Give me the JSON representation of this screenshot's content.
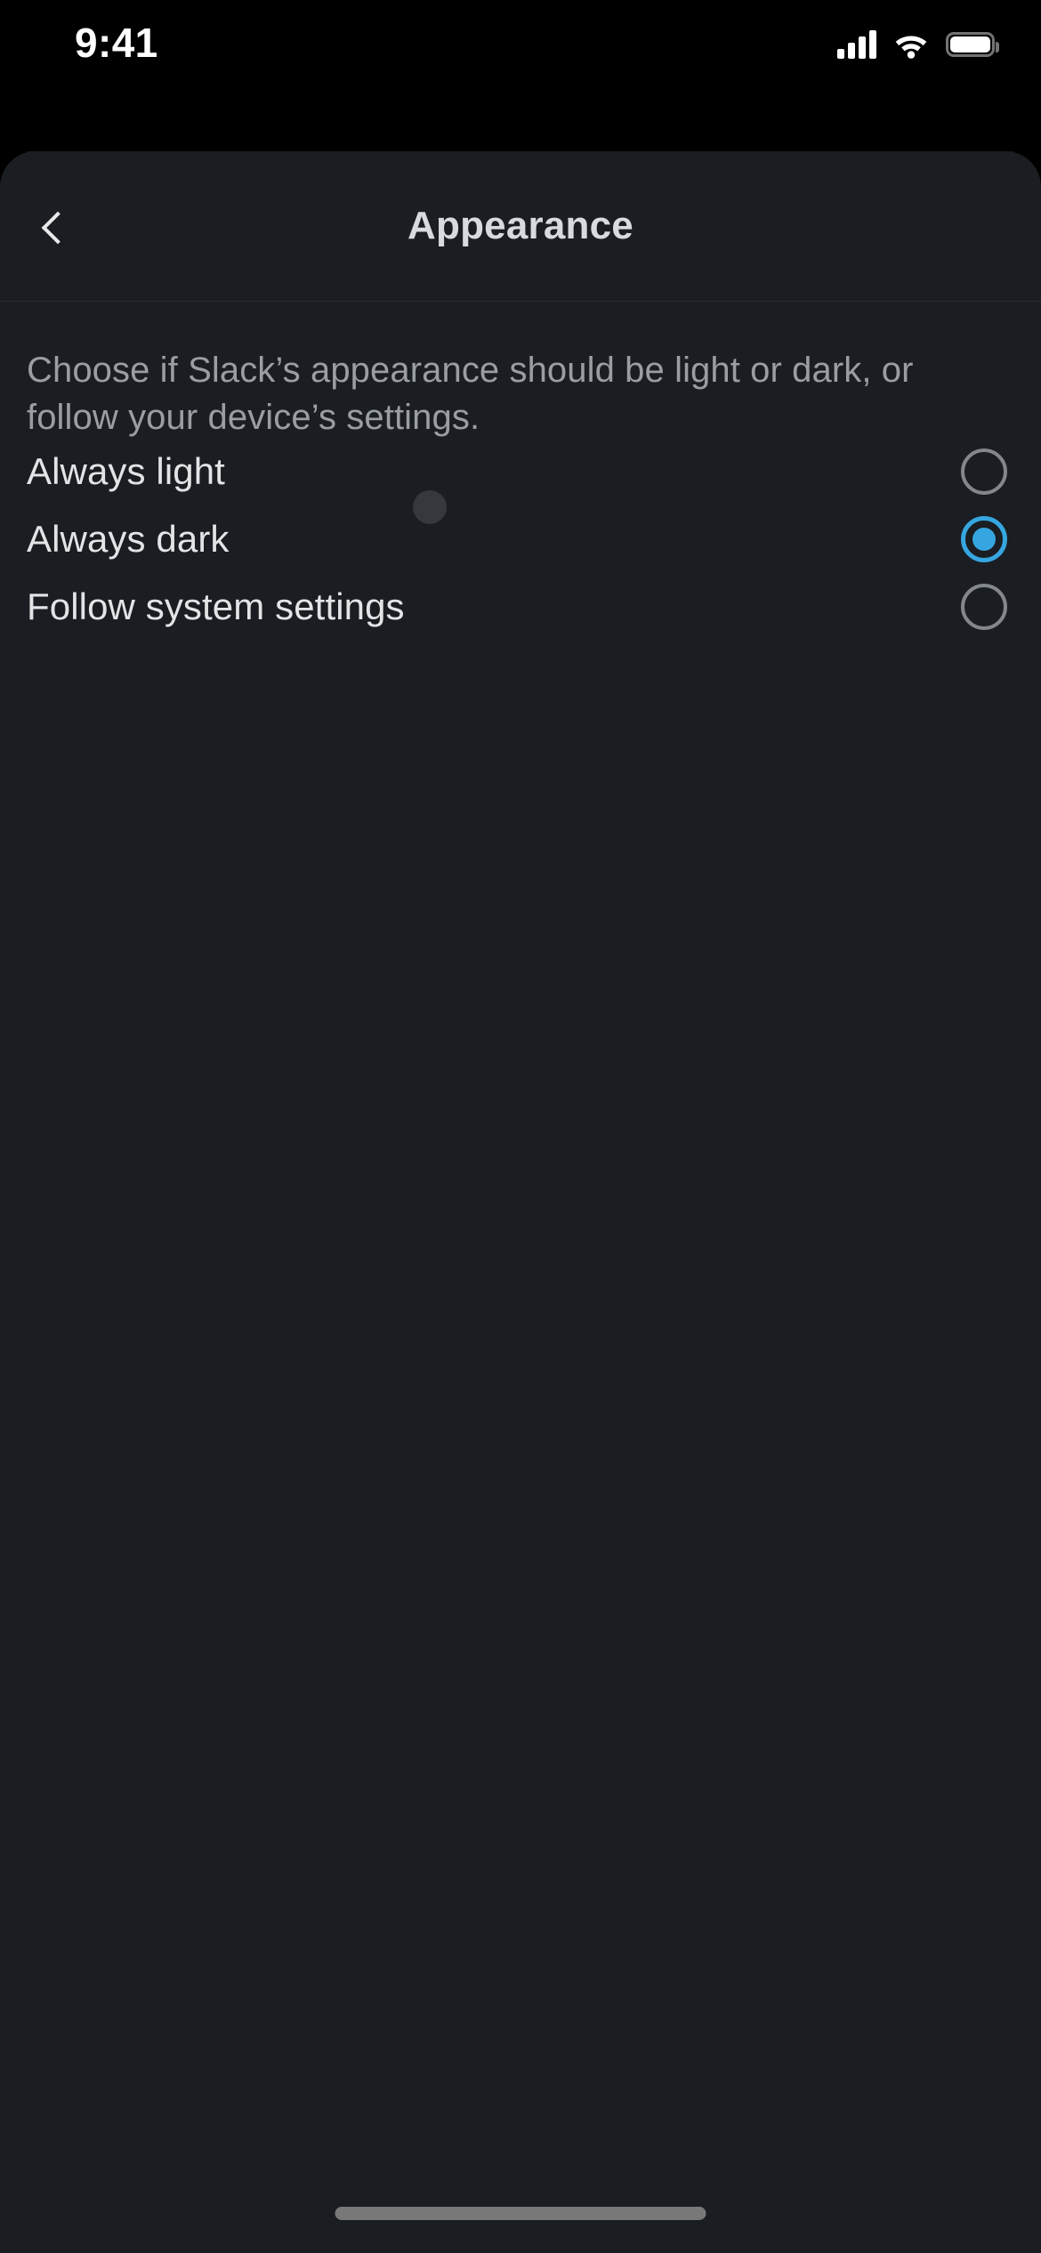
{
  "status_bar": {
    "time": "9:41",
    "cellular_icon": "cellular-signal-icon",
    "cellular_bars_filled": 4,
    "cellular_bars_total": 4,
    "wifi_icon": "wifi-icon",
    "battery_icon": "battery-icon",
    "battery_level_percent": 95
  },
  "navbar": {
    "back_icon": "chevron-left-icon",
    "title": "Appearance"
  },
  "main": {
    "description": "Choose if Slack’s appearance should be light or dark, or follow your device’s settings.",
    "options": [
      {
        "label": "Always light",
        "selected": false
      },
      {
        "label": "Always dark",
        "selected": true
      },
      {
        "label": "Follow system settings",
        "selected": false
      }
    ]
  },
  "colors": {
    "page_background": "#000000",
    "card_background": "#1a1d21",
    "card_back_background": "#15171a",
    "accent": "#36a6e0",
    "primary_text": "#e3e4e6",
    "secondary_text": "#9a9ea3",
    "radio_off_border": "#83878c",
    "divider": "#2a2d31",
    "home_indicator": "#787878",
    "ripple": "#35383d"
  },
  "home_indicator": {
    "name": "home-indicator"
  }
}
